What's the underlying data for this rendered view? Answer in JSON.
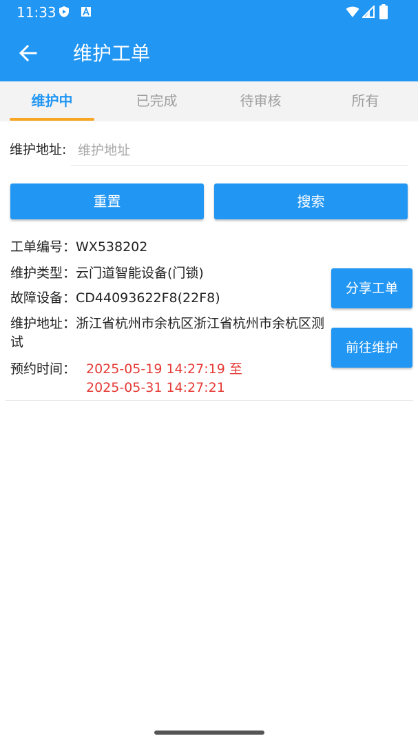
{
  "status_bar": {
    "time": "11:33",
    "icons": [
      "shield-play-icon",
      "font-a-icon",
      "wifi-icon",
      "signal-icon",
      "battery-icon"
    ]
  },
  "app_bar": {
    "back_icon": "arrow-left-icon",
    "title": "维护工单"
  },
  "tabs": [
    {
      "label": "维护中",
      "active": true
    },
    {
      "label": "已完成",
      "active": false
    },
    {
      "label": "待审核",
      "active": false
    },
    {
      "label": "所有",
      "active": false
    }
  ],
  "search": {
    "address_label": "维护地址:",
    "address_placeholder": "维护地址",
    "address_value": "",
    "reset_label": "重置",
    "search_label": "搜索"
  },
  "order": {
    "number_label": "工单编号：",
    "number": "WX538202",
    "type_label": "维护类型：",
    "type": "云门道智能设备(门锁)",
    "device_label": "故障设备：",
    "device": "CD44093622F8(22F8)",
    "address_label": "维护地址：",
    "address": "浙江省杭州市余杭区浙江省杭州市余杭区测试",
    "time_label": "预约时间：",
    "time_start": "2025-05-19 14:27:19 至",
    "time_end": "2025-05-31 14:27:21",
    "share_label": "分享工单",
    "goto_label": "前往维护"
  },
  "colors": {
    "primary": "#2196F3",
    "tab_indicator": "#F6A623",
    "time_text": "#E53935"
  }
}
